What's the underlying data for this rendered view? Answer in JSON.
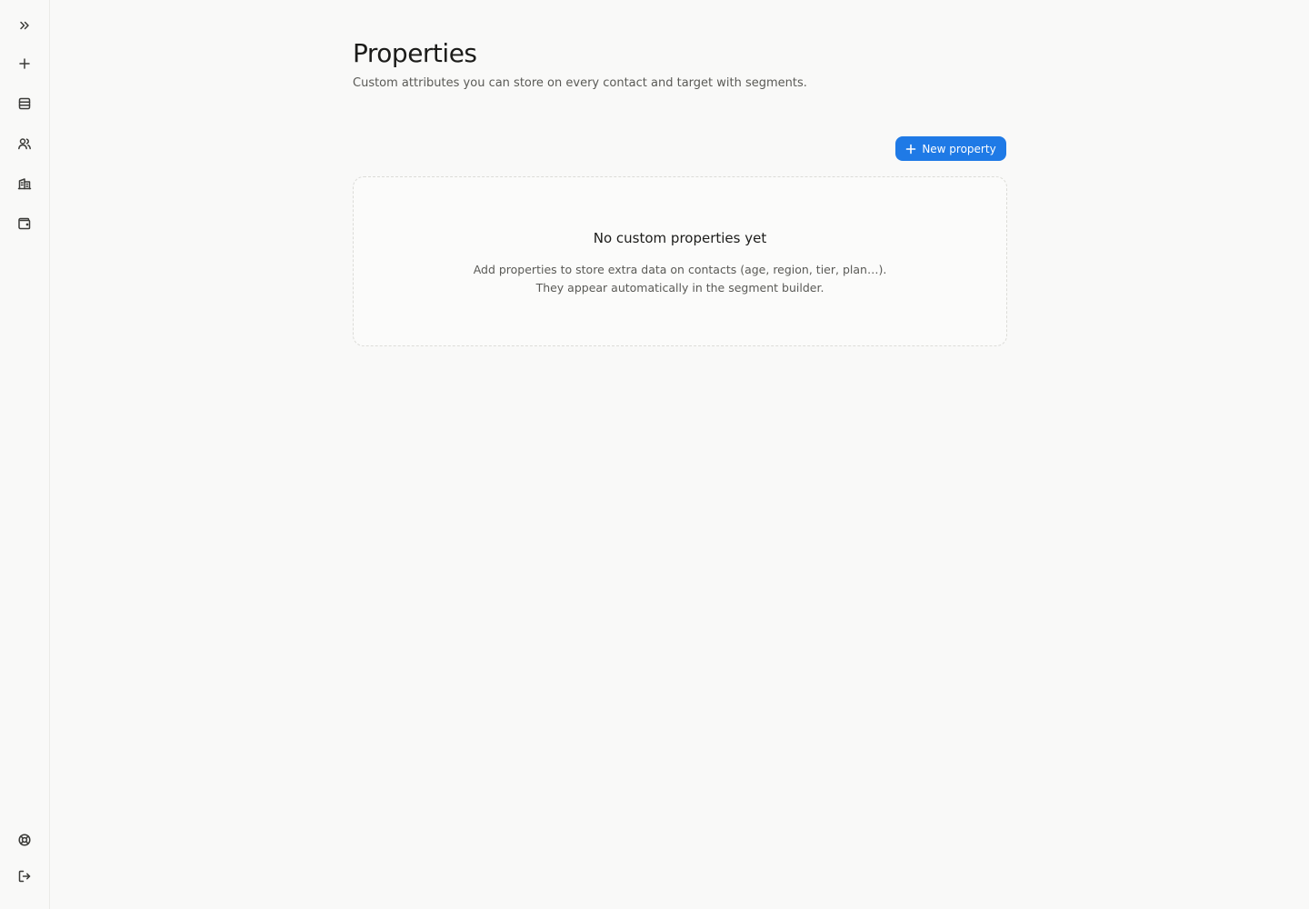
{
  "sidebar": {
    "top_items": [
      {
        "name": "expand",
        "icon": "chevrons-right-icon"
      },
      {
        "name": "create",
        "icon": "plus-icon"
      },
      {
        "name": "list",
        "icon": "rows-icon"
      },
      {
        "name": "contacts",
        "icon": "users-icon"
      },
      {
        "name": "companies",
        "icon": "building-icon"
      },
      {
        "name": "wallet",
        "icon": "wallet-icon"
      }
    ],
    "bottom_items": [
      {
        "name": "help",
        "icon": "life-buoy-icon"
      },
      {
        "name": "logout",
        "icon": "logout-icon"
      }
    ]
  },
  "header": {
    "title": "Properties",
    "subtitle": "Custom attributes you can store on every contact and target with segments."
  },
  "actions": {
    "new_property_label": "New property"
  },
  "empty_state": {
    "title": "No custom properties yet",
    "line1": "Add properties to store extra data on contacts (age, region, tier, plan…).",
    "line2": "They appear automatically in the segment builder."
  },
  "colors": {
    "accent": "#1f7ae6",
    "background": "#f9f9f8"
  }
}
